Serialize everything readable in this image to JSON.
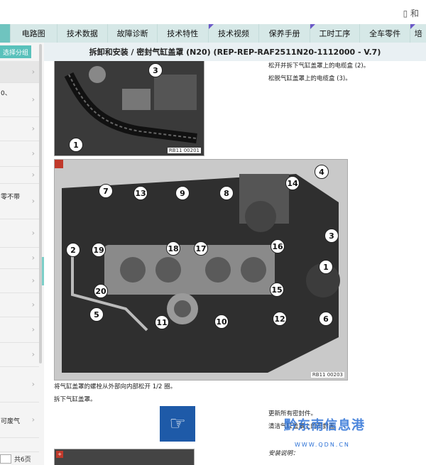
{
  "topbar": {
    "device_icon": "tablet-icon",
    "extra": "和"
  },
  "tabs": [
    {
      "label": ""
    },
    {
      "label": "电路图"
    },
    {
      "label": "技术数据"
    },
    {
      "label": "故障诊断"
    },
    {
      "label": "技术特性"
    },
    {
      "label": "技术视频"
    },
    {
      "label": "保养手册"
    },
    {
      "label": "工时工序"
    },
    {
      "label": "全车零件"
    },
    {
      "label": "培"
    }
  ],
  "sidebar": {
    "group_button": "选择分组",
    "rows": [
      {
        "label": ""
      },
      {
        "label": "0、"
      },
      {
        "label": ""
      },
      {
        "label": ""
      },
      {
        "label": ""
      },
      {
        "label": "零不带"
      },
      {
        "label": ""
      },
      {
        "label": ""
      },
      {
        "label": ""
      },
      {
        "label": ""
      },
      {
        "label": ""
      },
      {
        "label": ""
      },
      {
        "label": ""
      },
      {
        "label": "可废气"
      },
      {
        "label": ""
      }
    ],
    "pager_text": "共6页"
  },
  "header": {
    "title": "拆卸和安装 / 密封气缸盖罩 (N20) (REP-REP-RAF2511N20-1112000 - V.7)"
  },
  "content": {
    "step_right_1": "松开并拆下气缸盖罩上的电缆盒 (2)。",
    "step_right_2": "松脱气缸盖罩上的电缆盒 (3)。",
    "fig1_id": "RB11 00201",
    "fig1_callouts": [
      "1",
      "3"
    ],
    "fig2_id": "RB11 00203",
    "fig2_callouts": [
      "7",
      "13",
      "9",
      "8",
      "14",
      "4",
      "3",
      "1",
      "2",
      "19",
      "18",
      "17",
      "16",
      "20",
      "15",
      "5",
      "11",
      "10",
      "12",
      "6"
    ],
    "step_loosen": "将气缸盖罩的螺栓从外部向内部松开 1/2 圈。",
    "step_remove": "拆下气缸盖罩。",
    "renew_seals": "更新所有密封件。",
    "line_2": "清洁气缸盖罩上的密封面",
    "install_note": "安装说明：",
    "watermark": "黔东南信息港",
    "watermark_url": "WWW.QDN.CN"
  }
}
